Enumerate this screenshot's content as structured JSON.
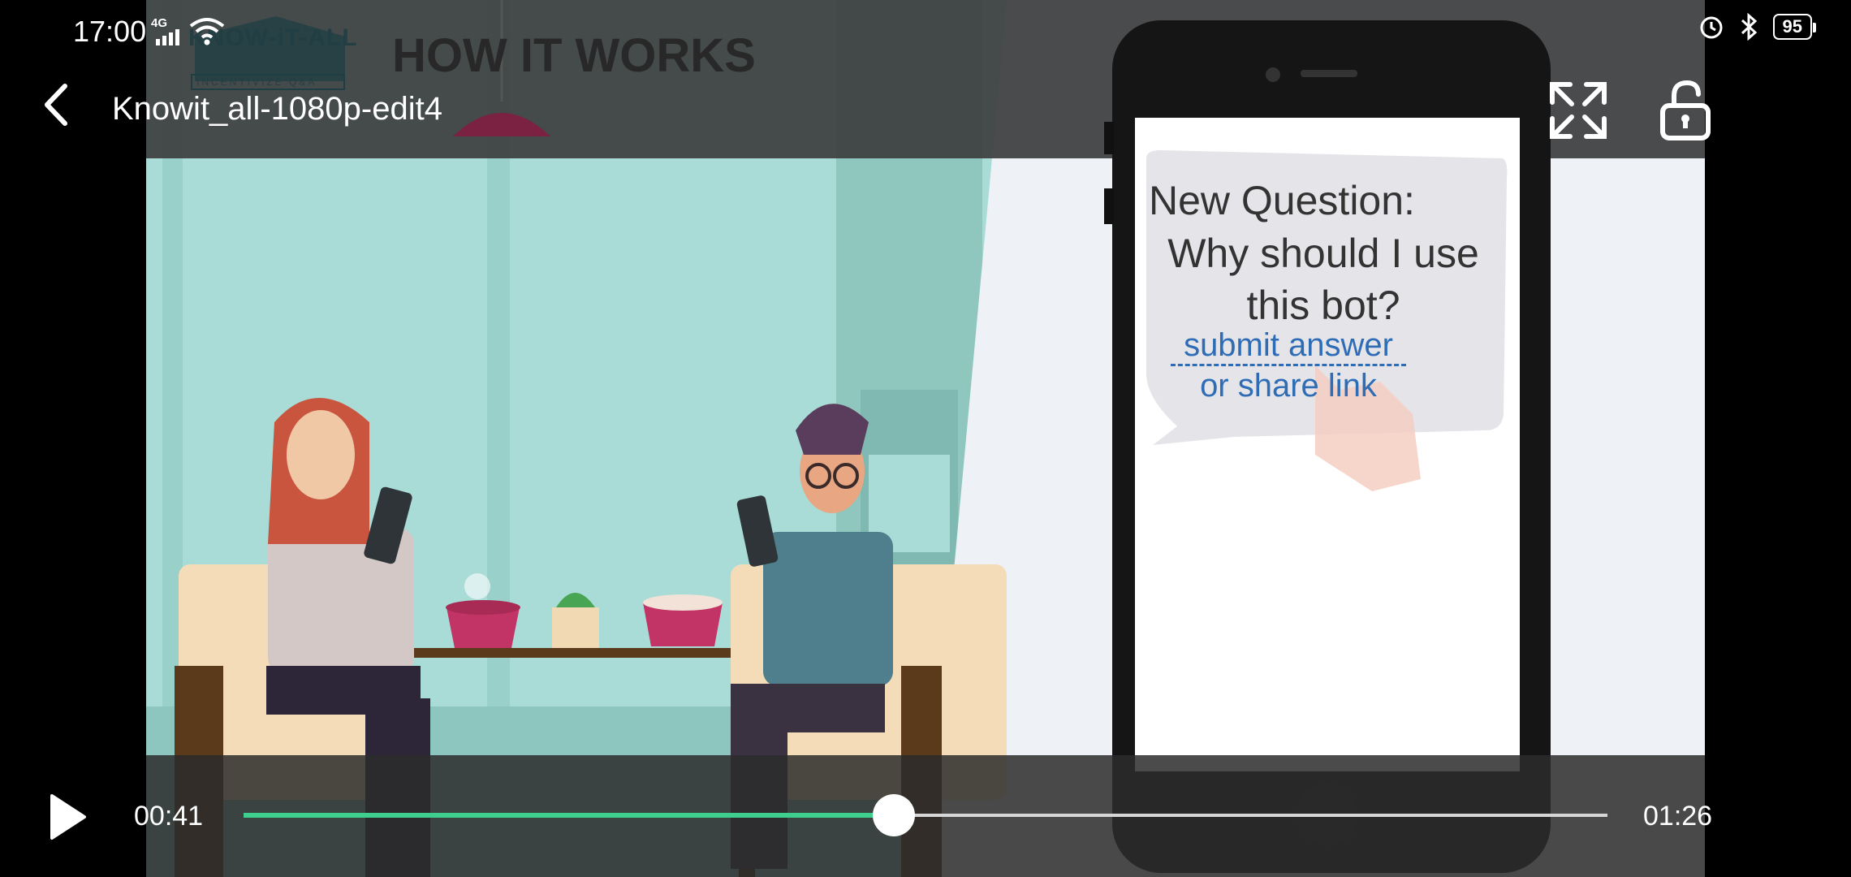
{
  "status_bar": {
    "time": "17:00",
    "network": "4G",
    "battery": "95",
    "icons": [
      "signal-icon",
      "wifi-icon",
      "alarm-icon",
      "bluetooth-icon",
      "battery-icon"
    ]
  },
  "header": {
    "title": "Knowit_all-1080p-edit4",
    "icons": [
      "back-icon",
      "fullscreen-icon",
      "unlock-icon"
    ]
  },
  "video": {
    "logo_text": "KNOW-iT-ALL",
    "logo_subtitle": "INCENTIVIZE Q&A",
    "heading": "HOW IT WORKS",
    "bubble": {
      "line1": "New Question:",
      "line2": "Why should I use",
      "line3": "this bot?",
      "link1": "submit answer",
      "link2": "or share link"
    }
  },
  "player": {
    "current_time": "00:41",
    "total_time": "01:26",
    "progress": 0.477,
    "accent_color": "#3ecf8e",
    "icons": [
      "play-icon"
    ]
  }
}
